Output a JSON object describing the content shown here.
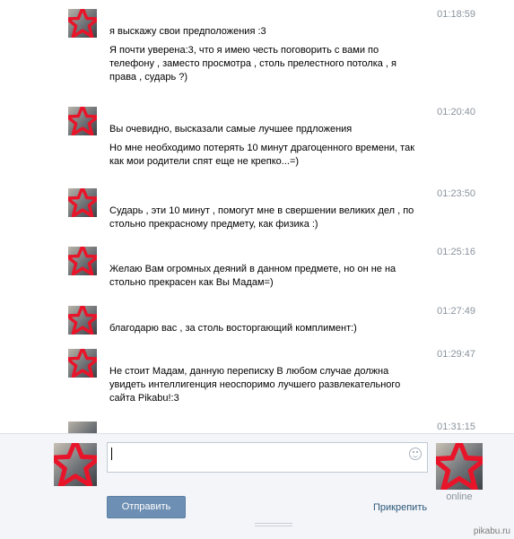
{
  "messages": [
    {
      "time": "01:18:59",
      "lines": [
        "я выскажу свои предположения :3",
        "Я почти уверена:3, что я имею честь поговорить с вами по телефону , заместо просмотра , столь прелестного потолка , я права , сударь ?)"
      ]
    },
    {
      "time": "01:20:40",
      "lines": [
        "Вы очевидно, высказали самые лучшее прдложения",
        "Но мне необходимо потерять 10 минут драгоценного времени, так как мои родители спят еще не крепко...=)"
      ]
    },
    {
      "time": "01:23:50",
      "lines": [
        "Сударь , эти 10 минут , помогут мне в свершении великих дел , по стольно прекрасному предмету, как физика :)"
      ]
    },
    {
      "time": "01:25:16",
      "lines": [
        "Желаю Вам огромных деяний в данном предмете, но он не на стольно прекрасен как Вы Мадам=)"
      ]
    },
    {
      "time": "01:27:49",
      "lines": [
        "благодарю вас , за столь восторгающий комплимент:)"
      ]
    },
    {
      "time": "01:29:47",
      "lines": [
        "Не стоит Мадам, данную переписку В любом случае должна увидеть интеллигенция неоспоримо лучшего развлекательного сайта Pikabu!:3"
      ]
    },
    {
      "time": "01:31:15",
      "lines": []
    }
  ],
  "composer": {
    "input_value": "",
    "send_label": "Отправить",
    "attach_label": "Прикрепить",
    "status": "online"
  },
  "watermark": "pikabu.ru",
  "icons": {
    "avatar_overlay": "red-star-icon",
    "emoji": "smiley-icon"
  },
  "colors": {
    "send_button": "#6d8fb3",
    "link": "#2b587a",
    "time": "#8a949e",
    "star": "#e8152a"
  }
}
